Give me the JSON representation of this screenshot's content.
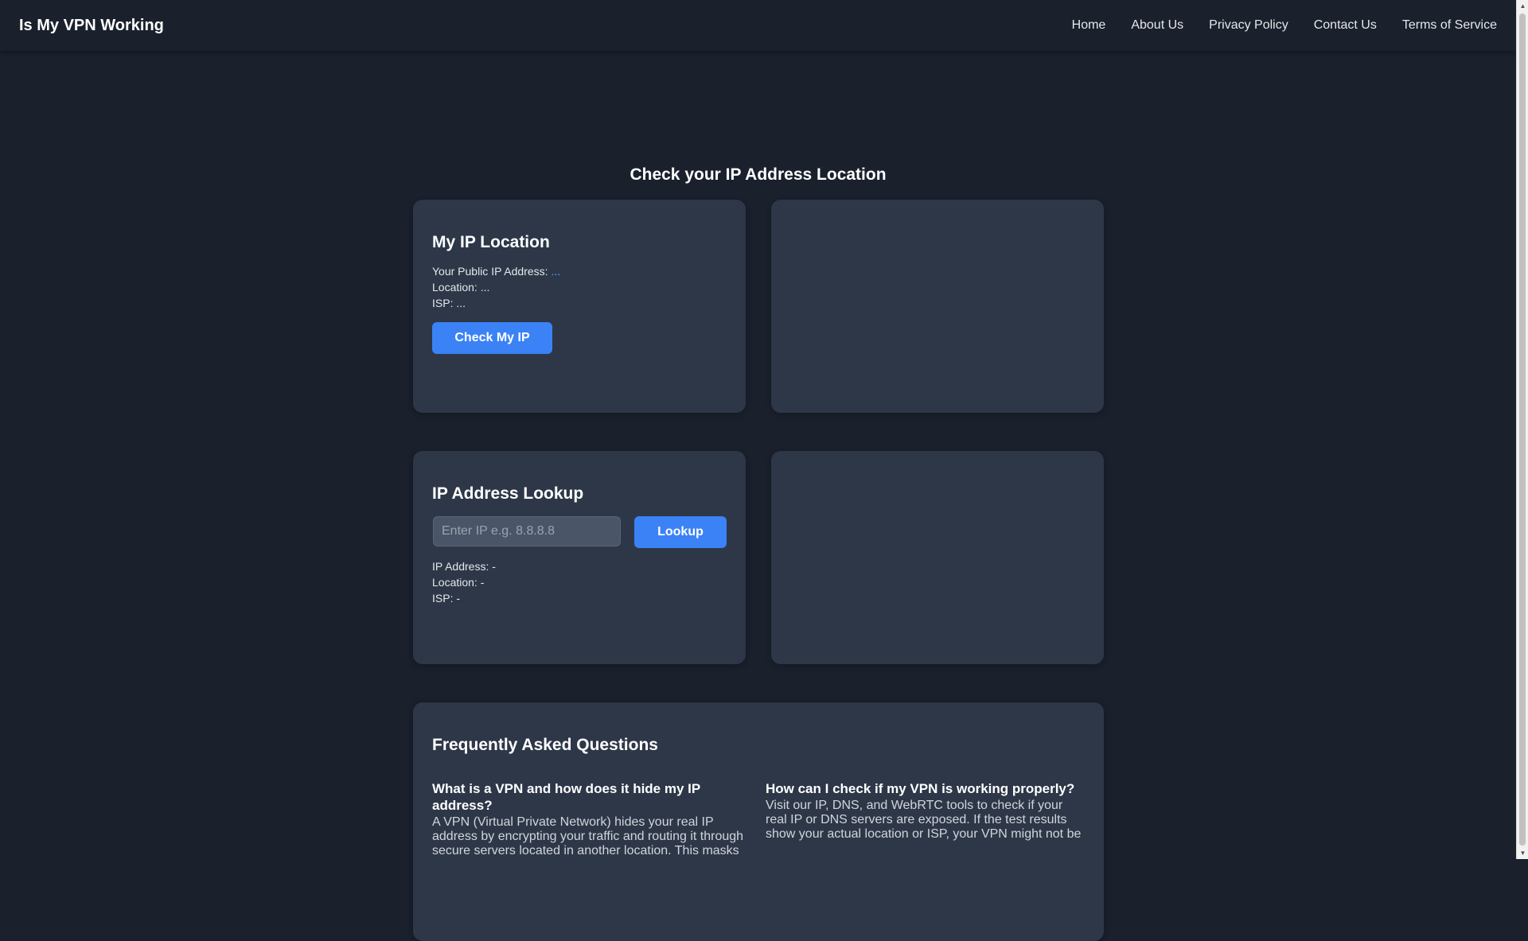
{
  "nav": {
    "brand": "Is My VPN Working",
    "links": [
      "Home",
      "About Us",
      "Privacy Policy",
      "Contact Us",
      "Terms of Service"
    ]
  },
  "main": {
    "title": "Check your IP Address Location"
  },
  "my_ip": {
    "title": "My IP Location",
    "ip_label": "Your Public IP Address: ",
    "ip_value": "...",
    "location_line": "Location: ...",
    "isp_line": "ISP: ...",
    "button_label": "Check My IP"
  },
  "lookup": {
    "title": "IP Address Lookup",
    "input_placeholder": "Enter IP e.g. 8.8.8.8",
    "input_value": "",
    "button_label": "Lookup",
    "ip_line": "IP Address: -",
    "location_line": "Location: -",
    "isp_line": "ISP: -"
  },
  "faq": {
    "title": "Frequently Asked Questions",
    "items": [
      {
        "question": "What is a VPN and how does it hide my IP address?",
        "answer": "A VPN (Virtual Private Network) hides your real IP address by encrypting your traffic and routing it through secure servers located in another location. This masks"
      },
      {
        "question": "How can I check if my VPN is working properly?",
        "answer": "Visit our IP, DNS, and WebRTC tools to check if your real IP or DNS servers are exposed. If the test results show your actual location or ISP, your VPN might not be"
      }
    ]
  },
  "colors": {
    "background": "#1a202c",
    "card": "#2d3748",
    "accent": "#3b82f6",
    "link_value": "#60a5fa"
  }
}
